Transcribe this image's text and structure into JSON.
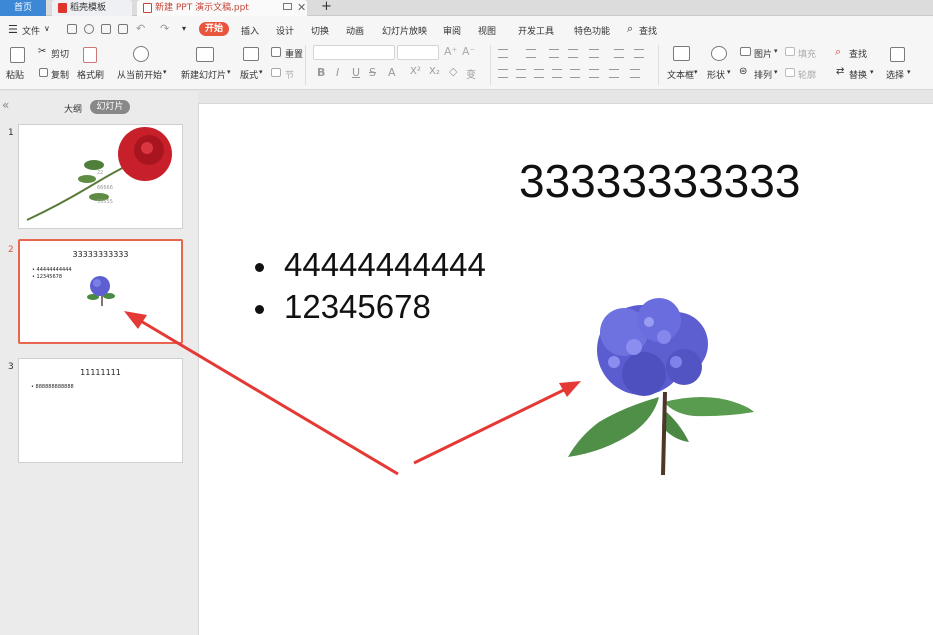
{
  "tabs": {
    "home": "首页",
    "templates": "稻壳模板",
    "document": "新建 PPT 演示文稿.ppt",
    "new_tab": "+"
  },
  "menu": {
    "file": "文件",
    "items": [
      "开始",
      "插入",
      "设计",
      "切换",
      "动画",
      "幻灯片放映",
      "审阅",
      "视图",
      "开发工具",
      "特色功能"
    ],
    "search": "查找"
  },
  "ribbon": {
    "paste": "粘贴",
    "cut": "剪切",
    "copy": "复制",
    "format_painter": "格式刷",
    "from_current": "从当前开始",
    "new_slide": "新建幻灯片",
    "layout": "版式",
    "section": "节",
    "reset": "重置",
    "textbox": "文本框",
    "shape": "形状",
    "picture": "图片",
    "fill": "填充",
    "arrange": "排列",
    "outline": "轮廓",
    "find": "查找",
    "replace": "替换",
    "select": "选择"
  },
  "left_pane": {
    "tab_outline": "大纲",
    "tab_slides": "幻灯片",
    "collapse": "«"
  },
  "thumbnails": [
    {
      "num": "1"
    },
    {
      "num": "2",
      "title": "33333333333",
      "bullets": [
        "44444444444",
        "12345678"
      ]
    },
    {
      "num": "3",
      "title": "11111111",
      "bullets": [
        "888888888888"
      ]
    }
  ],
  "slide": {
    "title": "33333333333",
    "bullets": [
      "44444444444",
      "12345678"
    ]
  },
  "colors": {
    "accent": "#e8543c",
    "arrow": "#e53935",
    "home_tab": "#3c87d6",
    "hydrangea": "#5d5fd0",
    "rose": "#c8202a"
  }
}
